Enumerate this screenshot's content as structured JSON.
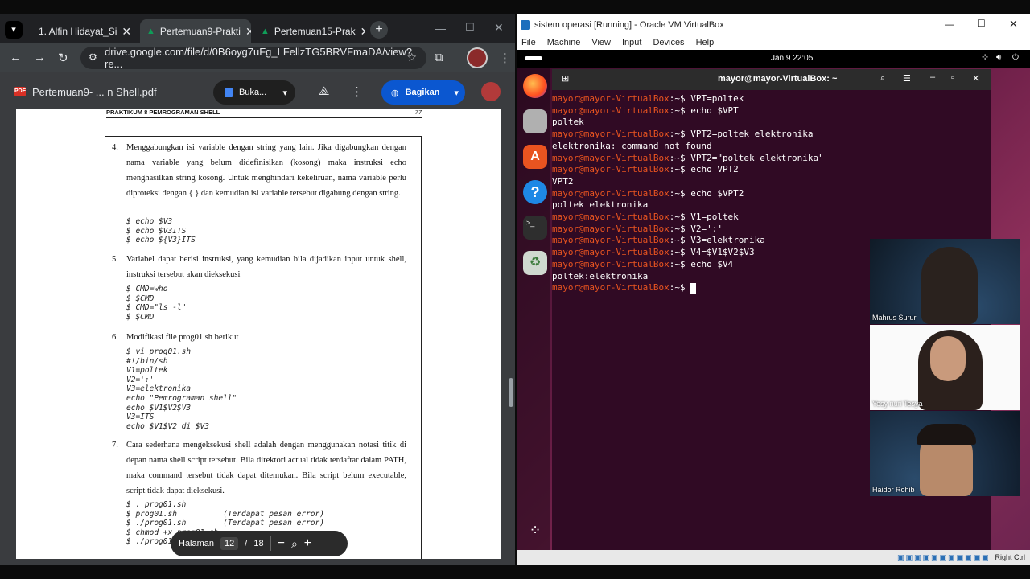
{
  "chrome": {
    "tabs": [
      {
        "label": "1. Alfin Hidayat_Si",
        "icon_color": "#f4b400"
      },
      {
        "label": "Pertemuan9-Prakti",
        "icon_color": "#0f9d58"
      },
      {
        "label": "Pertemuan15-Prak",
        "icon_color": "#0f9d58"
      }
    ],
    "url": "drive.google.com/file/d/0B6oyg7uFg_LFellzTG5BRVFmaDA/view?re...",
    "pdf_title": "Pertemuan9- ... n Shell.pdf",
    "open_button": "Buka...",
    "share_button": "Bagikan"
  },
  "pdf": {
    "header_left": "PRAKTIKUM 8 PEMROGRAMAN SHELL",
    "header_right": "77",
    "items": [
      {
        "num": "4.",
        "text": "Menggabungkan isi variable dengan string yang lain. Jika digabungkan dengan nama variable yang belum didefinisikan (kosong) maka instruksi echo menghasilkan string kosong. Untuk menghindari kekeliruan, nama variable perlu diproteksi dengan { } dan kemudian isi variable tersebut digabung dengan string.",
        "code": "$ echo $V3\n$ echo $V3ITS\n$ echo ${V3}ITS"
      },
      {
        "num": "5.",
        "text": "Variabel dapat berisi instruksi, yang kemudian bila dijadikan input untuk shell, instruksi tersebut akan dieksekusi",
        "code": "$ CMD=who\n$ $CMD\n$ CMD=\"ls -l\"\n$ $CMD"
      },
      {
        "num": "6.",
        "text": "Modifikasi file prog01.sh berikut",
        "code": "$ vi prog01.sh\n#!/bin/sh\nV1=poltek\nV2=':'\nV3=elektronika\necho \"Pemrograman shell\"\necho $V1$V2$V3\nV3=ITS\necho $V1$V2 di $V3"
      },
      {
        "num": "7.",
        "text": "Cara sederhana mengeksekusi shell adalah dengan menggunakan notasi titik di depan nama shell script tersebut. Bila direktori actual tidak terdaftar dalam PATH, maka command tersebut tidak dapat ditemukan. Bila script belum executable, script tidak dapat dieksekusi.",
        "code": "$ . prog01.sh\n$ prog01.sh          (Terdapat pesan error)\n$ ./prog01.sh        (Terdapat pesan error)\n$ chmod +x prog01.sh\n$ ./prog01.sh"
      }
    ],
    "page_label": "Halaman",
    "page_current": "12",
    "page_sep": "/",
    "page_total": "18"
  },
  "vbox": {
    "title": "sistem operasi [Running] - Oracle VM VirtualBox",
    "menu": [
      "File",
      "Machine",
      "View",
      "Input",
      "Devices",
      "Help"
    ],
    "clock": "Jan 9  22:05",
    "status_right": "Right Ctrl"
  },
  "terminal": {
    "title": "mayor@mayor-VirtualBox: ~",
    "prompt": "mayor@mayor-VirtualBox",
    "lines": [
      {
        "type": "cmd",
        "text": "VPT=poltek"
      },
      {
        "type": "cmd",
        "text": "echo $VPT"
      },
      {
        "type": "out",
        "text": "poltek"
      },
      {
        "type": "cmd",
        "text": "VPT2=poltek elektronika"
      },
      {
        "type": "out",
        "text": "elektronika: command not found"
      },
      {
        "type": "cmd",
        "text": "VPT2=\"poltek elektronika\""
      },
      {
        "type": "cmd",
        "text": "echo VPT2"
      },
      {
        "type": "out",
        "text": "VPT2"
      },
      {
        "type": "cmd",
        "text": "echo $VPT2"
      },
      {
        "type": "out",
        "text": "poltek elektronika"
      },
      {
        "type": "cmd",
        "text": "V1=poltek"
      },
      {
        "type": "cmd",
        "text": "V2=':'"
      },
      {
        "type": "cmd",
        "text": "V3=elektronika"
      },
      {
        "type": "cmd",
        "text": "V4=$V1$V2$V3"
      },
      {
        "type": "cmd",
        "text": "echo $V4"
      },
      {
        "type": "out",
        "text": "poltek:elektronika"
      },
      {
        "type": "cmd",
        "text": ""
      }
    ]
  },
  "participants": [
    {
      "name": "Mahrus Surur"
    },
    {
      "name": "Yesy nuri Tesya"
    },
    {
      "name": "Haidor Rohib"
    }
  ]
}
